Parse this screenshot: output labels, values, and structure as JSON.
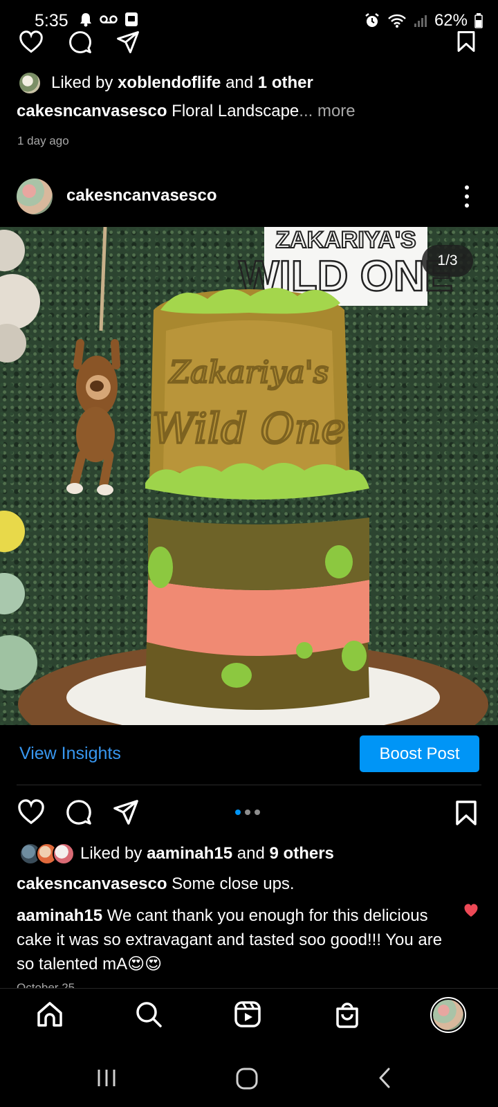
{
  "status_bar": {
    "time": "5:35",
    "battery": "62%"
  },
  "previous_post": {
    "liked_by_prefix": "Liked by ",
    "liked_by_user": "xoblendoflife",
    "liked_by_and": " and ",
    "liked_by_others": "1 other",
    "caption_user": "cakesncanvasesco",
    "caption_text": " Floral Landscape",
    "caption_more": "... more",
    "timestamp": "1 day ago"
  },
  "post": {
    "username": "cakesncanvasesco",
    "image_counter": "1/3",
    "sign_text_top": "ZAKARIYA'S",
    "sign_text_bottom": "WILD ONE",
    "cake_topper_text_1": "Zakariya's",
    "cake_topper_text_2": "Wild One",
    "view_insights": "View Insights",
    "boost_post": "Boost Post",
    "carousel_total": 3,
    "carousel_active": 0,
    "liked_by_prefix": "Liked by ",
    "liked_by_user": "aaminah15",
    "liked_by_and": " and ",
    "liked_by_others": "9 others",
    "caption_user": "cakesncanvasesco",
    "caption_text": " Some close ups.",
    "comment_user": "aaminah15",
    "comment_text": " We cant thank you enough for this delicious cake it was so extravagant and tasted soo good!!! You are so talented mA😍😍",
    "date_peek": "October 25"
  },
  "colors": {
    "accent_blue": "#0095f6",
    "link_blue": "#3897f0",
    "like_red": "#ed4956",
    "muted": "#a8a8a8"
  },
  "bottom_nav": [
    "home-icon",
    "search-icon",
    "reels-icon",
    "shop-icon",
    "profile-avatar"
  ],
  "system_nav": [
    "recent-apps-icon",
    "home-button-icon",
    "back-icon"
  ]
}
